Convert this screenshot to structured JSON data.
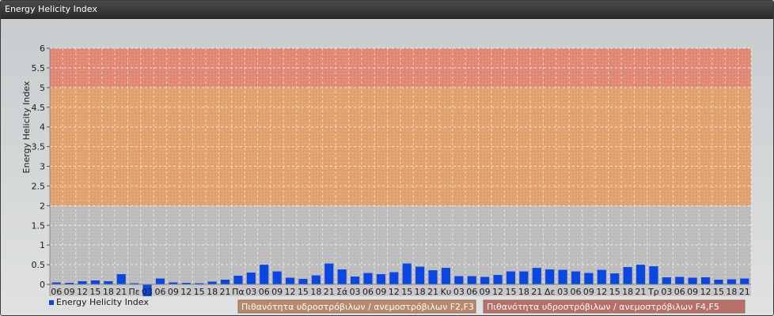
{
  "window": {
    "title": "Energy Helicity Index"
  },
  "chart_data": {
    "type": "bar",
    "ylabel": "Energy Helicity Index",
    "ylim": [
      -0.3,
      6
    ],
    "yticks": [
      0,
      0.5,
      1,
      1.5,
      2,
      2.5,
      3,
      3.5,
      4,
      4.5,
      5,
      5.5,
      6
    ],
    "ytick_labels": [
      "0",
      "0.5",
      "1",
      "1.5",
      "2",
      "2.5",
      "3",
      "3.5",
      "4",
      "4.5",
      "5",
      "5.5",
      "6"
    ],
    "grid": true,
    "bar_color": "#0a46e0",
    "bands": [
      {
        "from": 0,
        "to": 2,
        "color": "#bcbcbc"
      },
      {
        "from": 2,
        "to": 5,
        "color": "#e1a16d"
      },
      {
        "from": 5,
        "to": 6,
        "color": "#e08873"
      }
    ],
    "categories": [
      "06",
      "09",
      "12",
      "15",
      "18",
      "21",
      "Πε",
      "03",
      "06",
      "09",
      "12",
      "15",
      "18",
      "21",
      "Πα",
      "03",
      "06",
      "09",
      "12",
      "15",
      "18",
      "21",
      "Σά",
      "03",
      "06",
      "09",
      "12",
      "15",
      "18",
      "21",
      "Κυ",
      "03",
      "06",
      "09",
      "12",
      "15",
      "18",
      "21",
      "Δε",
      "03",
      "06",
      "09",
      "12",
      "15",
      "18",
      "21",
      "Τρ",
      "03",
      "06",
      "09",
      "12",
      "15",
      "18",
      "21"
    ],
    "series": [
      {
        "name": "Energy Helicity Index",
        "values": [
          0.05,
          0.04,
          0.08,
          0.1,
          0.08,
          0.26,
          0.03,
          -0.3,
          0.15,
          0.05,
          0.04,
          0.03,
          0.07,
          0.12,
          0.22,
          0.3,
          0.5,
          0.33,
          0.17,
          0.14,
          0.23,
          0.53,
          0.38,
          0.2,
          0.29,
          0.26,
          0.31,
          0.53,
          0.45,
          0.36,
          0.42,
          0.21,
          0.21,
          0.19,
          0.24,
          0.33,
          0.33,
          0.42,
          0.38,
          0.37,
          0.33,
          0.29,
          0.37,
          0.28,
          0.44,
          0.5,
          0.46,
          0.18,
          0.19,
          0.17,
          0.18,
          0.12,
          0.13,
          0.15
        ]
      }
    ],
    "legend": {
      "placement": "bottom-left",
      "items": [
        {
          "label": "Energy Helicity Index",
          "color": "#0a46e0"
        },
        {
          "label": "Πιθανότητα υδροστρόβιλων / ανεμοστρόβιλων F2,F3",
          "color": "#b8896a"
        },
        {
          "label": "Πιθανότητα υδροστρόβιλων / ανεμοστρόβιλων F4,F5",
          "color": "#b86f6a"
        }
      ]
    }
  }
}
